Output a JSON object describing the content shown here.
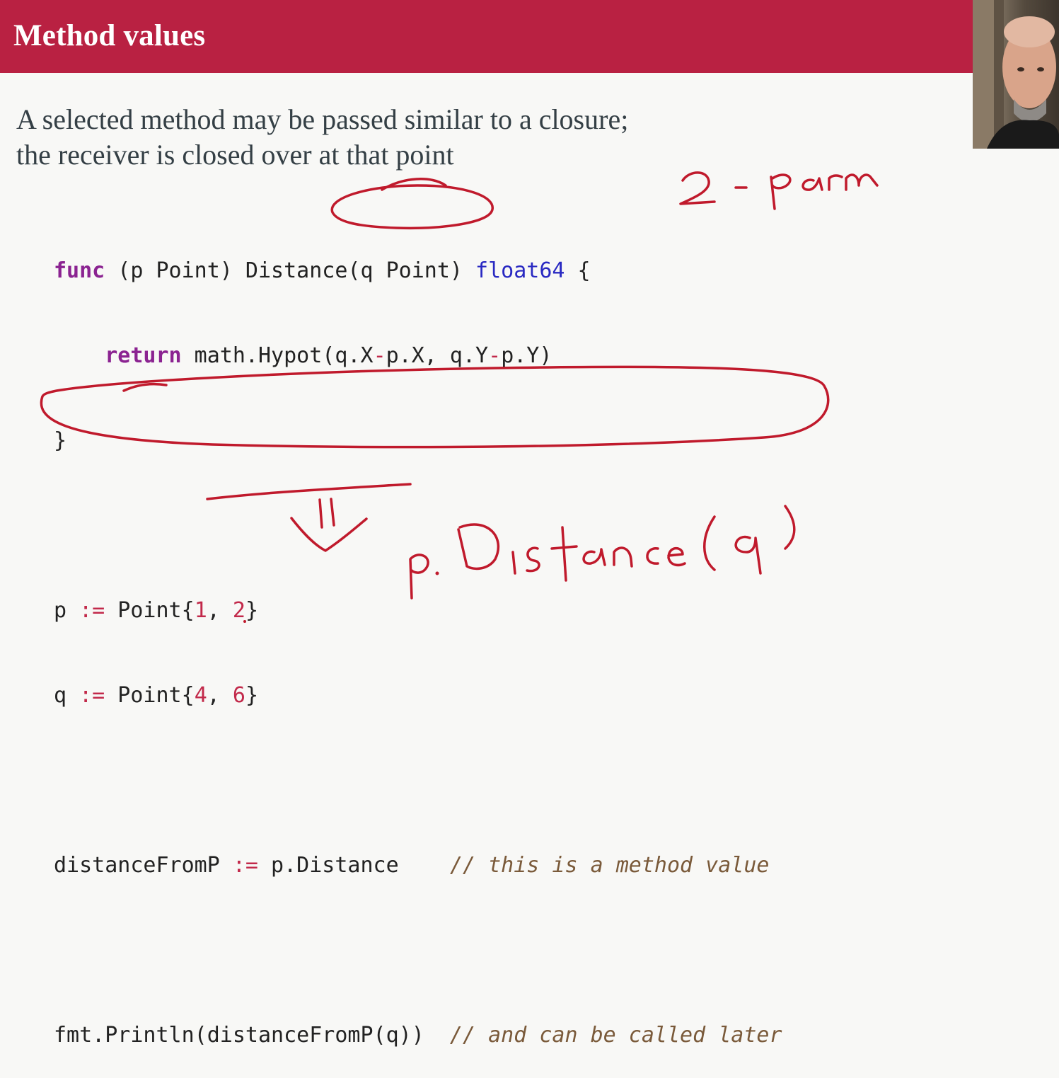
{
  "slide": {
    "title": "Method values",
    "description": [
      "A selected method may be passed similar to a closure;",
      "the receiver is closed over at that point"
    ]
  },
  "code": {
    "func_line": {
      "kw_func": "func",
      "recv": " (p Point) Distance(q Point) ",
      "ret_type": "float64",
      "brace": " {"
    },
    "return_line": {
      "indent": "    ",
      "kw_return": "return",
      "expr_a": " math.Hypot(q.X",
      "minus1": "-",
      "expr_b": "p.X, q.Y",
      "minus2": "-",
      "expr_c": "p.Y)"
    },
    "close_brace": "}",
    "p_line": {
      "name": "p ",
      "op": ":=",
      "ctor": " Point{",
      "n1": "1",
      "sep": ", ",
      "n2": "2",
      "end": "}"
    },
    "q_line": {
      "name": "q ",
      "op": ":=",
      "ctor": " Point{",
      "n1": "4",
      "sep": ", ",
      "n2": "6",
      "end": "}"
    },
    "method_value_line": {
      "name": "distanceFromP ",
      "op": ":=",
      "value": " p.Distance    ",
      "comment": "// this is a method value"
    },
    "call_line": {
      "call": "fmt.Println(distanceFromP(q))  ",
      "comment": "// and can be called later"
    }
  },
  "annotations": {
    "ink_color": "#c01a2c",
    "handwritten": [
      "2-parm",
      "p.Distance(q)"
    ]
  },
  "colors": {
    "title_bar": "#b92142",
    "keyword": "#8b2391",
    "type": "#2929c2",
    "operator": "#c2294a",
    "comment": "#7a5a3a"
  }
}
